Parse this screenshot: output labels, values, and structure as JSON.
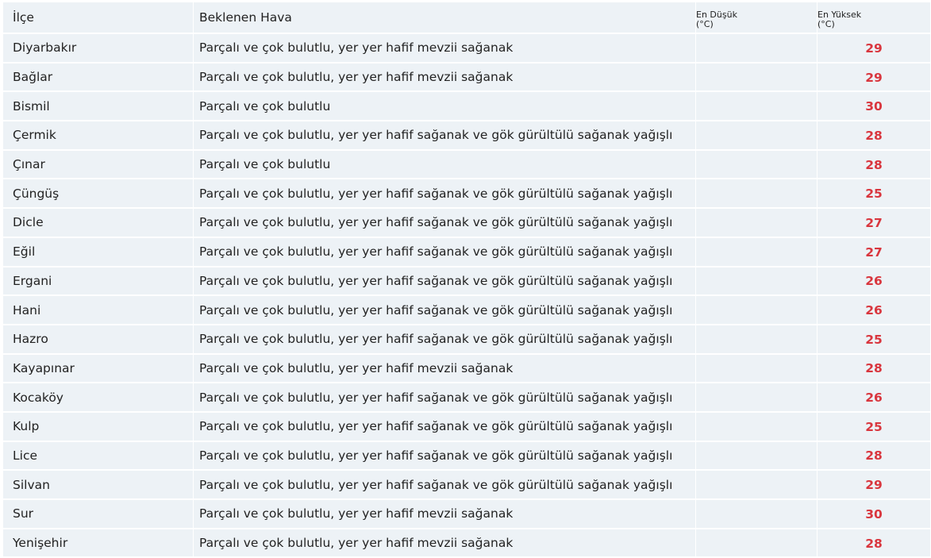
{
  "header": {
    "ilce": "İlçe",
    "hava": "Beklenen Hava",
    "min_line1": "En Düşük",
    "min_line2": "(°C)",
    "max_line1": "En Yüksek",
    "max_line2": "(°C)"
  },
  "rows": [
    {
      "ilce": "Diyarbakır",
      "hava": "Parçalı ve çok bulutlu, yer yer hafif mevzii sağanak",
      "min": "",
      "max": "29"
    },
    {
      "ilce": "Bağlar",
      "hava": "Parçalı ve çok bulutlu, yer yer hafif mevzii sağanak",
      "min": "",
      "max": "29"
    },
    {
      "ilce": "Bismil",
      "hava": "Parçalı ve çok bulutlu",
      "min": "",
      "max": "30"
    },
    {
      "ilce": "Çermik",
      "hava": "Parçalı ve çok bulutlu, yer yer hafif sağanak ve gök gürültülü sağanak yağışlı",
      "min": "",
      "max": "28"
    },
    {
      "ilce": "Çınar",
      "hava": "Parçalı ve çok bulutlu",
      "min": "",
      "max": "28"
    },
    {
      "ilce": "Çüngüş",
      "hava": "Parçalı ve çok bulutlu, yer yer hafif sağanak ve gök gürültülü sağanak yağışlı",
      "min": "",
      "max": "25"
    },
    {
      "ilce": "Dicle",
      "hava": "Parçalı ve çok bulutlu, yer yer hafif sağanak ve gök gürültülü sağanak yağışlı",
      "min": "",
      "max": "27"
    },
    {
      "ilce": "Eğil",
      "hava": "Parçalı ve çok bulutlu, yer yer hafif sağanak ve gök gürültülü sağanak yağışlı",
      "min": "",
      "max": "27"
    },
    {
      "ilce": "Ergani",
      "hava": "Parçalı ve çok bulutlu, yer yer hafif sağanak ve gök gürültülü sağanak yağışlı",
      "min": "",
      "max": "26"
    },
    {
      "ilce": "Hani",
      "hava": "Parçalı ve çok bulutlu, yer yer hafif sağanak ve gök gürültülü sağanak yağışlı",
      "min": "",
      "max": "26"
    },
    {
      "ilce": "Hazro",
      "hava": "Parçalı ve çok bulutlu, yer yer hafif sağanak ve gök gürültülü sağanak yağışlı",
      "min": "",
      "max": "25"
    },
    {
      "ilce": "Kayapınar",
      "hava": "Parçalı ve çok bulutlu, yer yer hafif mevzii sağanak",
      "min": "",
      "max": "28"
    },
    {
      "ilce": "Kocaköy",
      "hava": "Parçalı ve çok bulutlu, yer yer hafif sağanak ve gök gürültülü sağanak yağışlı",
      "min": "",
      "max": "26"
    },
    {
      "ilce": "Kulp",
      "hava": "Parçalı ve çok bulutlu, yer yer hafif sağanak ve gök gürültülü sağanak yağışlı",
      "min": "",
      "max": "25"
    },
    {
      "ilce": "Lice",
      "hava": "Parçalı ve çok bulutlu, yer yer hafif sağanak ve gök gürültülü sağanak yağışlı",
      "min": "",
      "max": "28"
    },
    {
      "ilce": "Silvan",
      "hava": "Parçalı ve çok bulutlu, yer yer hafif sağanak ve gök gürültülü sağanak yağışlı",
      "min": "",
      "max": "29"
    },
    {
      "ilce": "Sur",
      "hava": "Parçalı ve çok bulutlu, yer yer hafif mevzii sağanak",
      "min": "",
      "max": "30"
    },
    {
      "ilce": "Yenişehir",
      "hava": "Parçalı ve çok bulutlu, yer yer hafif mevzii sağanak",
      "min": "",
      "max": "28"
    }
  ],
  "colors": {
    "row_background": "#edf2f6",
    "max_temp": "#d9363e",
    "text": "#222222"
  }
}
